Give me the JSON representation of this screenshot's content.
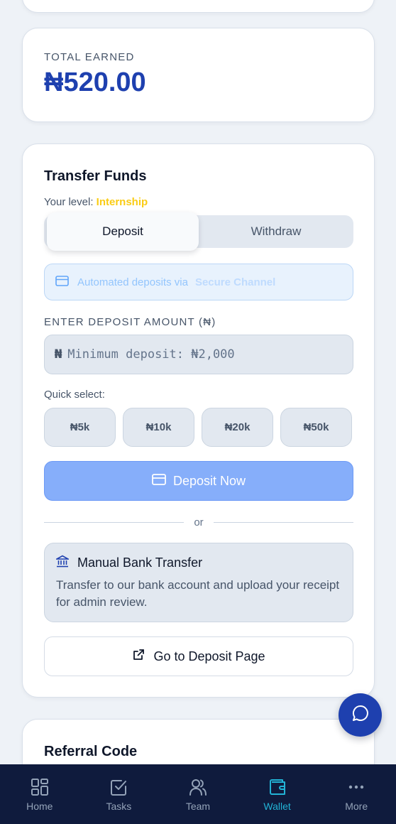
{
  "earned": {
    "label": "TOTAL EARNED",
    "value": "₦520.00"
  },
  "transfer": {
    "title": "Transfer Funds",
    "level_prefix": "Your level:",
    "level_value": "Internship",
    "tabs": [
      {
        "label": "Deposit",
        "active": true
      },
      {
        "label": "Withdraw",
        "active": false
      }
    ],
    "info_text": "Automated deposits via",
    "info_channel": "Secure Channel",
    "amount_label": "ENTER DEPOSIT AMOUNT (₦)",
    "amount_prefix": "₦",
    "amount_placeholder": "Minimum deposit: ₦2,000",
    "amount_value": "",
    "quick_label": "Quick select:",
    "quick_options": [
      "₦5k",
      "₦10k",
      "₦20k",
      "₦50k"
    ],
    "deposit_button": "Deposit Now",
    "divider_text": "or",
    "manual": {
      "title": "Manual Bank Transfer",
      "description": "Transfer to our bank account and upload your receipt for admin review."
    },
    "goto_button": "Go to Deposit Page"
  },
  "referral": {
    "title": "Referral Code"
  },
  "nav": {
    "items": [
      {
        "label": "Home",
        "icon": "grid-icon",
        "active": false
      },
      {
        "label": "Tasks",
        "icon": "checkbox-icon",
        "active": false
      },
      {
        "label": "Team",
        "icon": "users-icon",
        "active": false
      },
      {
        "label": "Wallet",
        "icon": "wallet-icon",
        "active": true
      },
      {
        "label": "More",
        "icon": "more-dots-icon",
        "active": false
      }
    ]
  },
  "colors": {
    "accent": "#1e40af",
    "level": "#facc15",
    "nav_bg": "#0f1b3d",
    "nav_active": "#22b3d6"
  }
}
